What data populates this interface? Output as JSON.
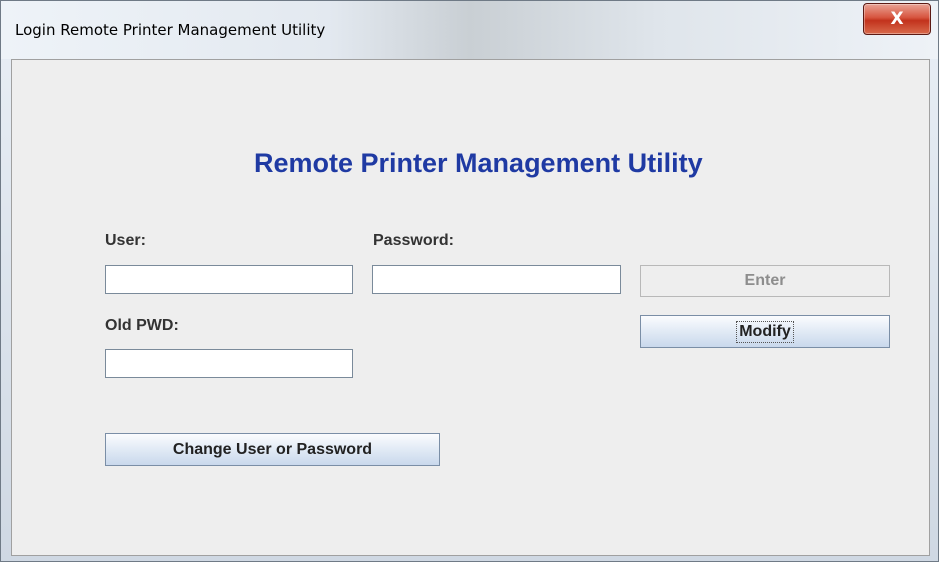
{
  "window": {
    "title": "Login Remote Printer Management Utility",
    "close_glyph": "X"
  },
  "form": {
    "heading": "Remote Printer Management Utility",
    "user_label": "User:",
    "user_value": "",
    "password_label": "Password:",
    "password_value": "",
    "old_pwd_label": "Old PWD:",
    "old_pwd_value": "",
    "enter_button": "Enter",
    "modify_button": "Modify",
    "change_button": "Change User or Password"
  },
  "colors": {
    "heading": "#1f3aa3",
    "close_button": "#c2321c"
  }
}
